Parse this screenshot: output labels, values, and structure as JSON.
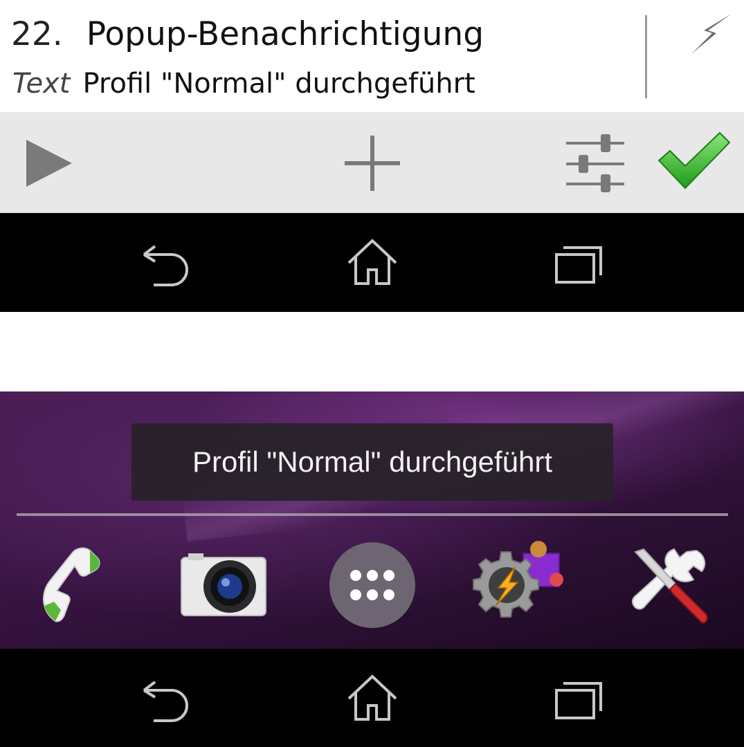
{
  "action_edit": {
    "number": "22.",
    "name": "Popup-Benachrichtigung",
    "param_label": "Text",
    "param_value": "Profil \"Normal\" durchgeführt"
  },
  "toolbar": {
    "icons": [
      "play-icon",
      "plus-icon",
      "sliders-icon",
      "checkmark-icon"
    ]
  },
  "navbar": {
    "icons": [
      "back-icon",
      "home-icon",
      "recents-icon"
    ]
  },
  "homescreen": {
    "toast_text": "Profil \"Normal\" durchgeführt",
    "dock_apps": [
      "phone-icon",
      "camera-icon",
      "app-drawer-icon",
      "tasker-icon",
      "tools-icon"
    ]
  },
  "colors": {
    "toolbar_bg": "#e8e8e8",
    "accent_check": "#3fbf2f",
    "wallpaper": "#3a1545",
    "toast_bg": "#28222a"
  }
}
